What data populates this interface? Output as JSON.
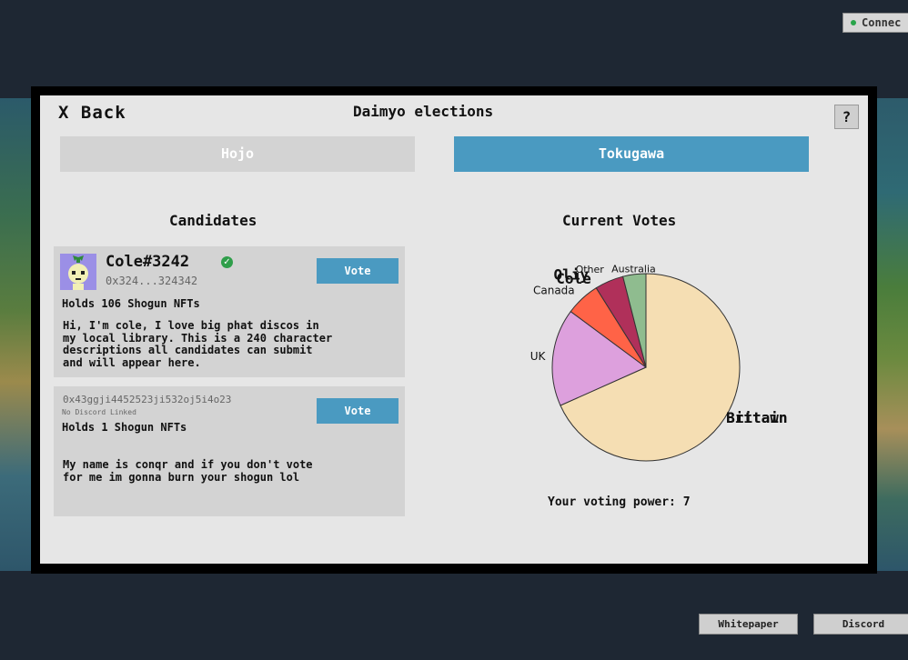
{
  "status": {
    "connection_label": "Connec"
  },
  "header": {
    "back_label": "X Back",
    "title": "Daimyo elections",
    "help_label": "?"
  },
  "tabs": [
    {
      "label": "Hojo"
    },
    {
      "label": "Tokugawa"
    }
  ],
  "candidates": {
    "section_title": "Candidates",
    "items": [
      {
        "name": "Cole#3242",
        "address": "0x324...324342",
        "holds": "Holds 106 Shogun NFTs",
        "description": "Hi, I'm cole, I love big phat discos in\nmy local library. This is a 240 character\ndescriptions all candidates can submit\nand will appear here.",
        "vote_label": "Vote"
      },
      {
        "name": "0x43ggji4452523ji532oj5i4o23",
        "discord_status": "No Discord Linked",
        "holds": "Holds 1 Shogun NFTs",
        "description": "My name is conqr and if you don't vote\nfor me im gonna burn your shogun lol",
        "vote_label": "Vote"
      }
    ]
  },
  "votes": {
    "section_title": "Current Votes",
    "voting_power": "Your voting power: 7"
  },
  "chart_data": {
    "type": "pie",
    "labels": [
      "Bittawn",
      "UK",
      "Canada",
      "Oliy",
      "Cole",
      "Other",
      "Australia"
    ],
    "label_overlay": [
      "Britain",
      "",
      "",
      "",
      "",
      "",
      ""
    ],
    "values": [
      69,
      17,
      6,
      0,
      0,
      5,
      4
    ],
    "colors": [
      "#f5deb3",
      "#dda0dd",
      "#ff6347",
      "#b0305a",
      "#b0305a",
      "#b0305a",
      "#8fbc8f"
    ]
  },
  "footer": {
    "whitepaper_label": "Whitepaper",
    "discord_label": "Discord"
  }
}
